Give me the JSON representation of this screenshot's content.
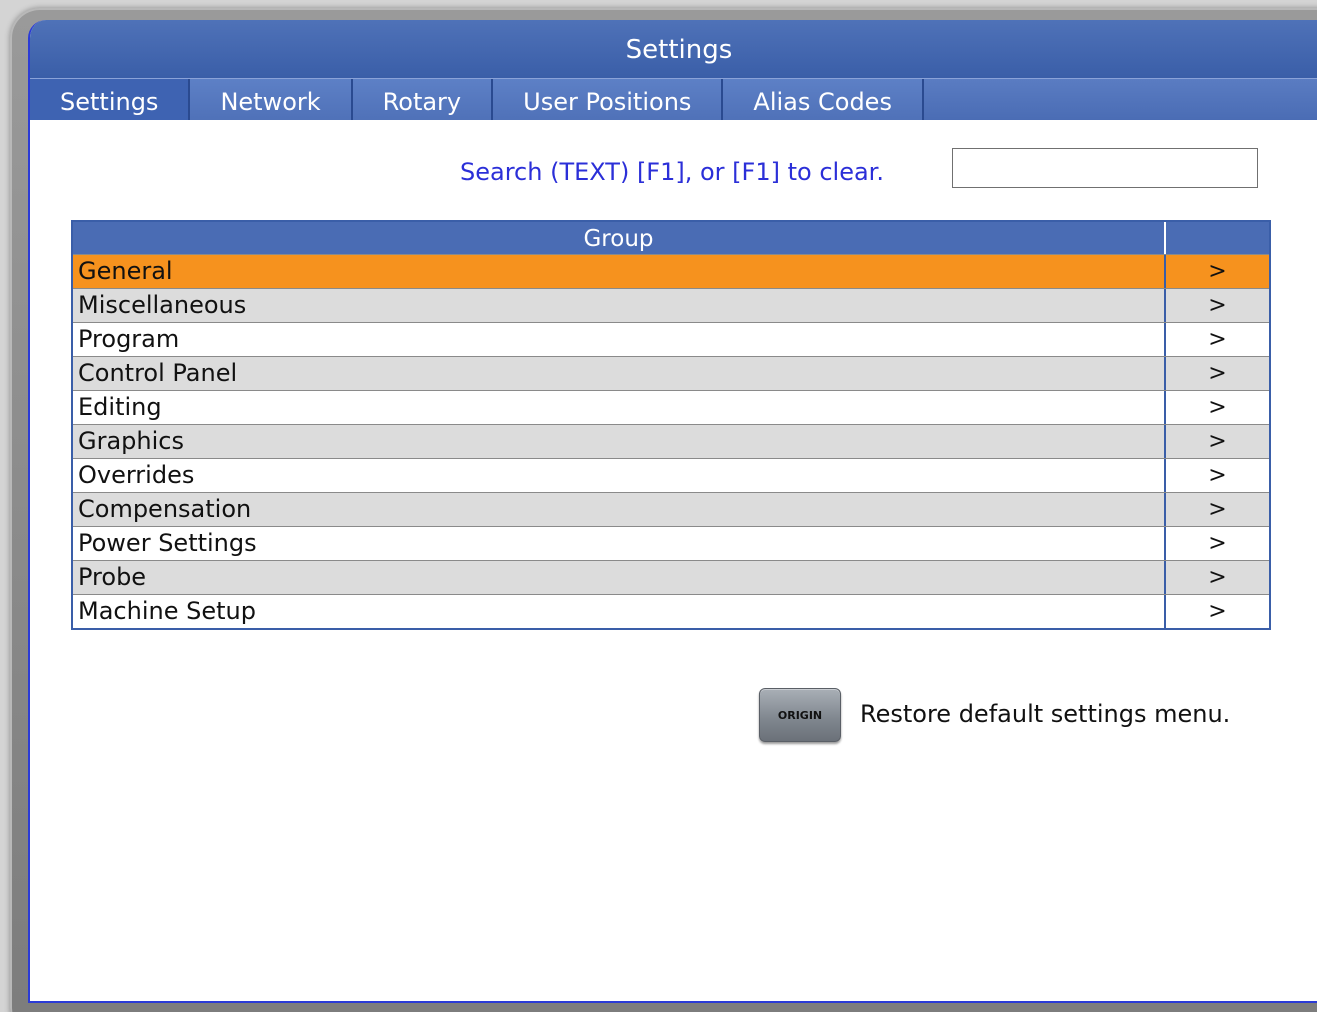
{
  "window": {
    "title": "Settings"
  },
  "tabs": [
    {
      "label": "Settings",
      "active": true
    },
    {
      "label": "Network",
      "active": false
    },
    {
      "label": "Rotary",
      "active": false
    },
    {
      "label": "User Positions",
      "active": false
    },
    {
      "label": "Alias Codes",
      "active": false
    }
  ],
  "search": {
    "label": "Search (TEXT) [F1], or [F1] to clear.",
    "value": "",
    "placeholder": ""
  },
  "group_table": {
    "header": "Group",
    "rows": [
      {
        "name": "General",
        "arrow": ">",
        "selected": true
      },
      {
        "name": "Miscellaneous",
        "arrow": ">"
      },
      {
        "name": "Program",
        "arrow": ">"
      },
      {
        "name": "Control Panel",
        "arrow": ">"
      },
      {
        "name": "Editing",
        "arrow": ">"
      },
      {
        "name": "Graphics",
        "arrow": ">"
      },
      {
        "name": "Overrides",
        "arrow": ">"
      },
      {
        "name": "Compensation",
        "arrow": ">"
      },
      {
        "name": "Power Settings",
        "arrow": ">"
      },
      {
        "name": "Probe",
        "arrow": ">"
      },
      {
        "name": "Machine Setup",
        "arrow": ">"
      }
    ]
  },
  "footer": {
    "origin_key_label": "ORIGIN",
    "restore_text": "Restore default settings menu."
  },
  "colors": {
    "title_bar": "#3a5ea8",
    "tab_bar": "#4a6cb4",
    "selected_row": "#f6921e",
    "alt_row": "#dcdcdc",
    "search_label": "#2b2fd8"
  }
}
